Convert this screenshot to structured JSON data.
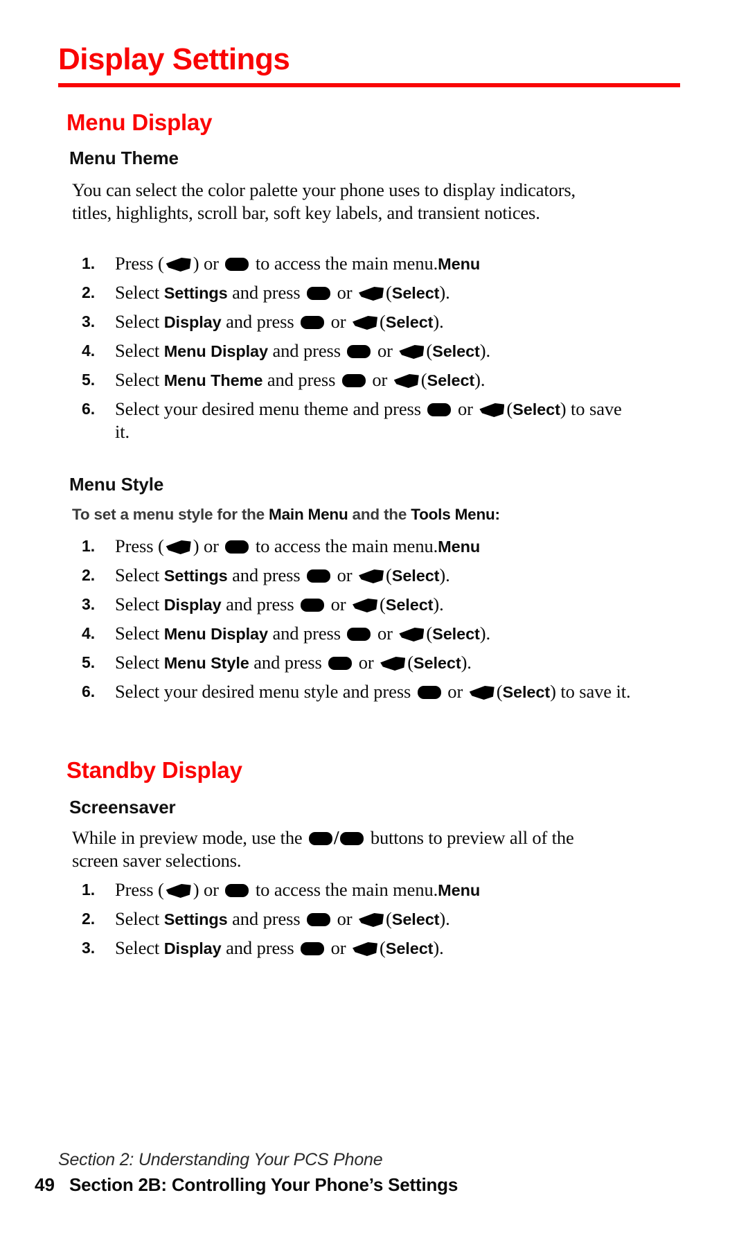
{
  "document": {
    "title": "Display Settings",
    "accent_color": "#f90505",
    "text_color": "#0b0b0b",
    "background_color": "#ffffff"
  },
  "sections": [
    {
      "heading": "Menu Display",
      "subsections": [
        {
          "subheading": "Menu Theme",
          "intro": "You can select the color palette your phone uses to display indicators, titles, highlights, scroll bar, soft key labels, and transient notices."
        },
        {
          "subheading": "Menu Style",
          "lead_prefix": "To set a menu style for the ",
          "lead_bold1": "Main Menu",
          "lead_mid": " and the ",
          "lead_bold2": "Tools Menu",
          "lead_suffix": ":"
        }
      ]
    },
    {
      "heading": "Standby Display",
      "subsections": [
        {
          "subheading": "Screensaver",
          "preview_part1": "While in preview mode, use the ",
          "preview_part2": " buttons to preview all of the screen saver selections."
        }
      ]
    }
  ],
  "steps_menu_theme": [
    {
      "num": "1.",
      "p1": "Press ",
      "icon1": "soft-key-icon",
      "p2": "(",
      "b1": "Menu",
      "p3": ") or ",
      "icon2": "ok-key-icon",
      "p4": " to access the main menu."
    },
    {
      "num": "2.",
      "p1": "Select ",
      "b0": "Settings",
      "p2": " and press ",
      "icon1": "ok-key-icon",
      "p3": " or ",
      "icon2": "soft-key-icon",
      "p4": "(",
      "b1": "Select",
      "p5": ")."
    },
    {
      "num": "3.",
      "p1": "Select ",
      "b0": "Display",
      "p2": " and press ",
      "icon1": "ok-key-icon",
      "p3": " or ",
      "icon2": "soft-key-icon",
      "p4": "(",
      "b1": "Select",
      "p5": ")."
    },
    {
      "num": "4.",
      "p1": "Select ",
      "b0": "Menu Display",
      "p2": " and press ",
      "icon1": "ok-key-icon",
      "p3": " or ",
      "icon2": "soft-key-icon",
      "p4": "(",
      "b1": "Select",
      "p5": ")."
    },
    {
      "num": "5.",
      "p1": "Select ",
      "b0": "Menu Theme",
      "p2": " and press ",
      "icon1": "ok-key-icon",
      "p3": " or ",
      "icon2": "soft-key-icon",
      "p4": "(",
      "b1": "Select",
      "p5": ")."
    },
    {
      "num": "6.",
      "p1": "Select your desired menu theme and press ",
      "icon1": "ok-key-icon",
      "p3": " or ",
      "icon2": "soft-key-icon",
      "p4": "(",
      "b1": "Select",
      "p5": ") to save it."
    }
  ],
  "steps_menu_style": [
    {
      "num": "1.",
      "p1": "Press ",
      "icon1": "soft-key-icon",
      "p2": "(",
      "b1": "Menu",
      "p3": ") or ",
      "icon2": "ok-key-icon",
      "p4": " to access the main menu."
    },
    {
      "num": "2.",
      "p1": "Select ",
      "b0": "Settings",
      "p2": " and press ",
      "icon1": "ok-key-icon",
      "p3": " or ",
      "icon2": "soft-key-icon",
      "p4": "(",
      "b1": "Select",
      "p5": ")."
    },
    {
      "num": "3.",
      "p1": "Select ",
      "b0": "Display",
      "p2": " and press ",
      "icon1": "ok-key-icon",
      "p3": " or ",
      "icon2": "soft-key-icon",
      "p4": "(",
      "b1": "Select",
      "p5": ")."
    },
    {
      "num": "4.",
      "p1": "Select ",
      "b0": "Menu Display",
      "p2": " and press ",
      "icon1": "ok-key-icon",
      "p3": " or ",
      "icon2": "soft-key-icon",
      "p4": "(",
      "b1": "Select",
      "p5": ")."
    },
    {
      "num": "5.",
      "p1": "Select ",
      "b0": "Menu Style",
      "p2": " and press ",
      "icon1": "ok-key-icon",
      "p3": " or ",
      "icon2": "soft-key-icon",
      "p4": "(",
      "b1": "Select",
      "p5": ")."
    },
    {
      "num": "6.",
      "p1": "Select your desired menu style and press ",
      "icon1": "ok-key-icon",
      "p3": " or ",
      "icon2": "soft-key-icon",
      "p4": "(",
      "b1": "Select",
      "p5": ") to save it."
    }
  ],
  "steps_screensaver": [
    {
      "num": "1.",
      "p1": "Press ",
      "icon1": "soft-key-icon",
      "p2": "(",
      "b1": "Menu",
      "p3": ") or ",
      "icon2": "ok-key-icon",
      "p4": " to access the main menu."
    },
    {
      "num": "2.",
      "p1": "Select ",
      "b0": "Settings",
      "p2": " and press ",
      "icon1": "ok-key-icon",
      "p3": " or ",
      "icon2": "soft-key-icon",
      "p4": "(",
      "b1": "Select",
      "p5": ")."
    },
    {
      "num": "3.",
      "p1": "Select ",
      "b0": "Display",
      "p2": " and press ",
      "icon1": "ok-key-icon",
      "p3": " or ",
      "icon2": "soft-key-icon",
      "p4": "(",
      "b1": "Select",
      "p5": ")."
    }
  ],
  "footer": {
    "running_head": "Section 2: Understanding Your PCS Phone",
    "page_number": "49",
    "section_label": "Section 2B: Controlling Your Phone’s Settings"
  }
}
